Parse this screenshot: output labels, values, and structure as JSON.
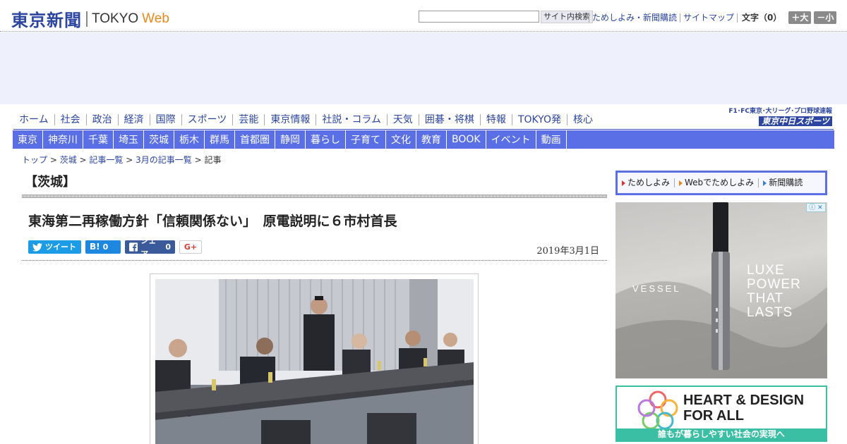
{
  "header": {
    "logo_jp": "東京新聞",
    "logo_en": "TOKYO",
    "logo_web": "Web",
    "search_placeholder": "",
    "search_button": "サイト内検索",
    "links": [
      "ためしよみ・新聞購読",
      "サイトマップ"
    ],
    "font_label": "文字（0）",
    "font_larger": "＋大",
    "font_smaller": "－小"
  },
  "nav_primary": [
    "ホーム",
    "社会",
    "政治",
    "経済",
    "国際",
    "スポーツ",
    "芸能",
    "東京情報",
    "社説・コラム",
    "天気",
    "囲碁・将棋",
    "特報",
    "TOKYO発",
    "核心"
  ],
  "chunichi": {
    "tagline": "F1･FC東京･大リーグ･プロ野球速報",
    "logo": "東京中日スポーツ"
  },
  "nav_regional": [
    "東京",
    "神奈川",
    "千葉",
    "埼玉",
    "茨城",
    "栃木",
    "群馬",
    "首都圏",
    "静岡",
    "暮らし",
    "子育て",
    "文化",
    "教育",
    "BOOK",
    "イベント",
    "動画"
  ],
  "breadcrumb": {
    "items": [
      "トップ",
      "茨城",
      "記事一覧",
      "3月の記事一覧"
    ],
    "separator": " > ",
    "current": "記事"
  },
  "article": {
    "section": "【茨城】",
    "headline": "東海第二再稼働方針「信頼関係ない」　原電説明に６市村首長",
    "date": "2019年3月1日"
  },
  "share": {
    "tweet": "ツイート",
    "hatena_icon": "B!",
    "hatena_count": "0",
    "facebook_label": "シェア",
    "facebook_count": "0",
    "gplus": "G+"
  },
  "promo": {
    "items": [
      "ためしよみ",
      "Webでためしよみ",
      "新聞購読"
    ]
  },
  "ad_vessel": {
    "brand": "VESSEL",
    "copy_lines": [
      "LUXE",
      "POWER",
      "THAT",
      "LASTS"
    ]
  },
  "ad_heart": {
    "title_lines": [
      "HEART & DESIGN",
      "FOR ALL"
    ],
    "subtitle": "誰もが暮らしやすい社会の実現へ"
  }
}
